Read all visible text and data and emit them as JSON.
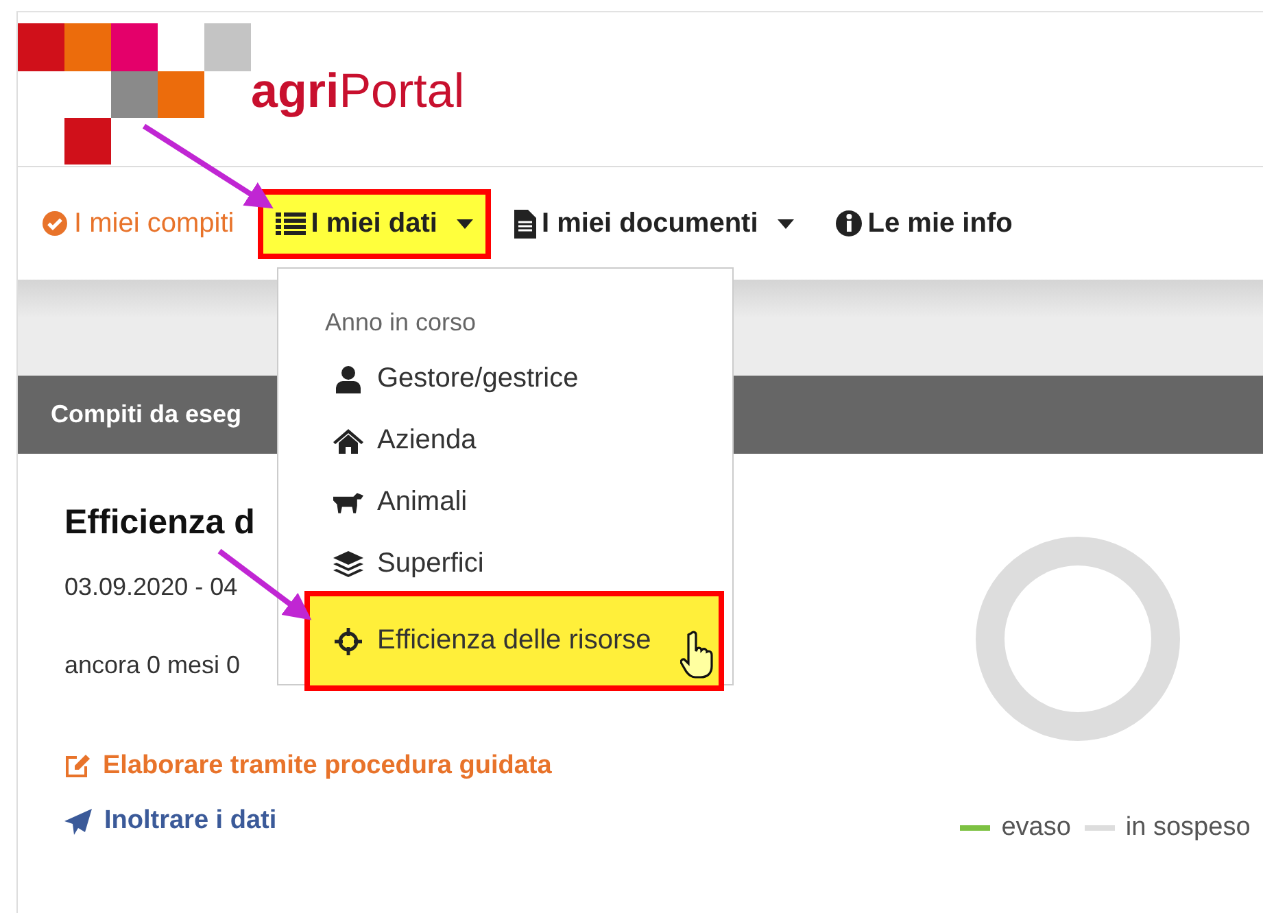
{
  "header": {
    "logo_text": "**agri**Portal"
  },
  "nav": [
    {
      "label": "I miei compiti",
      "selected": true,
      "highlighted": false,
      "dropdown": false
    },
    {
      "label": "I miei dati",
      "selected": false,
      "highlighted": true,
      "dropdown": true
    },
    {
      "label": "I miei documenti",
      "selected": false,
      "highlighted": false,
      "dropdown": true
    },
    {
      "label": "Le mie info",
      "selected": false,
      "highlighted": false,
      "dropdown": false
    }
  ],
  "dropdown_menu": {
    "heading": "Anno in corso",
    "items": [
      {
        "label": "Gestore/gestrice",
        "highlighted": false
      },
      {
        "label": "Azienda",
        "highlighted": false
      },
      {
        "label": "Animali",
        "highlighted": false
      },
      {
        "label": "Superfici",
        "highlighted": false
      },
      {
        "label": "Efficienza delle risorse",
        "highlighted": true
      }
    ]
  },
  "panel": {
    "title": "Compiti da eseg"
  },
  "task": {
    "title": "Efficienza d",
    "dates": "03.09.2020 - 04",
    "remaining": "ancora 0 mesi 0",
    "actions": [
      {
        "label": "Elaborare tramite procedura guidata",
        "kind": "edit"
      },
      {
        "label": "Inoltrare i dati",
        "kind": "send"
      }
    ]
  },
  "legend": [
    {
      "label": "evaso",
      "color": "#7dc142"
    },
    {
      "label": "in sospeso",
      "color": "#dddddd"
    }
  ]
}
